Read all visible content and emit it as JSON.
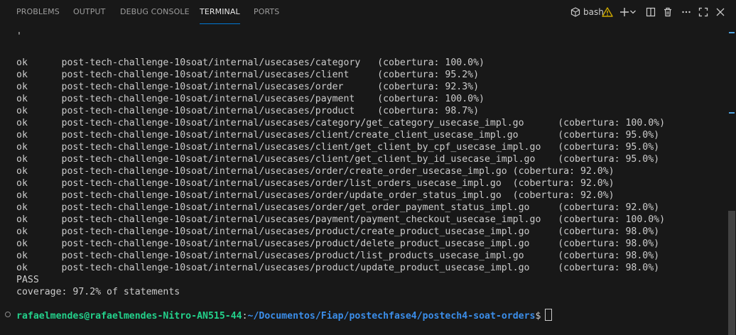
{
  "tabs": [
    {
      "label": "PROBLEMS",
      "active": false
    },
    {
      "label": "OUTPUT",
      "active": false
    },
    {
      "label": "DEBUG CONSOLE",
      "active": false
    },
    {
      "label": "TERMINAL",
      "active": true
    },
    {
      "label": "PORTS",
      "active": false
    }
  ],
  "toolbar": {
    "shell_label": "bash",
    "icons": [
      "terminal-profile-icon",
      "warning-icon",
      "add-icon",
      "chevron-down-icon",
      "split-icon",
      "trash-icon",
      "ellipsis-icon",
      "maximize-icon",
      "close-icon"
    ]
  },
  "colors": {
    "accent": "#0078d4",
    "warning": "#cca700",
    "prompt_user": "#23d18b",
    "prompt_path": "#3b8eea"
  },
  "terminal": {
    "lines": [
      "'",
      "",
      "ok      post-tech-challenge-10soat/internal/usecases/category   (cobertura: 100.0%)",
      "ok      post-tech-challenge-10soat/internal/usecases/client     (cobertura: 95.2%)",
      "ok      post-tech-challenge-10soat/internal/usecases/order      (cobertura: 92.3%)",
      "ok      post-tech-challenge-10soat/internal/usecases/payment    (cobertura: 100.0%)",
      "ok      post-tech-challenge-10soat/internal/usecases/product    (cobertura: 98.7%)",
      "ok      post-tech-challenge-10soat/internal/usecases/category/get_category_usecase_impl.go      (cobertura: 100.0%)",
      "ok      post-tech-challenge-10soat/internal/usecases/client/create_client_usecase_impl.go       (cobertura: 95.0%)",
      "ok      post-tech-challenge-10soat/internal/usecases/client/get_client_by_cpf_usecase_impl.go   (cobertura: 95.0%)",
      "ok      post-tech-challenge-10soat/internal/usecases/client/get_client_by_id_usecase_impl.go    (cobertura: 95.0%)",
      "ok      post-tech-challenge-10soat/internal/usecases/order/create_order_usecase_impl.go (cobertura: 92.0%)",
      "ok      post-tech-challenge-10soat/internal/usecases/order/list_orders_usecase_impl.go  (cobertura: 92.0%)",
      "ok      post-tech-challenge-10soat/internal/usecases/order/update_order_status_impl.go  (cobertura: 92.0%)",
      "ok      post-tech-challenge-10soat/internal/usecases/order/get_order_payment_status_impl.go     (cobertura: 92.0%)",
      "ok      post-tech-challenge-10soat/internal/usecases/payment/payment_checkout_usecase_impl.go   (cobertura: 100.0%)",
      "ok      post-tech-challenge-10soat/internal/usecases/product/create_product_usecase_impl.go     (cobertura: 98.0%)",
      "ok      post-tech-challenge-10soat/internal/usecases/product/delete_product_usecase_impl.go     (cobertura: 98.0%)",
      "ok      post-tech-challenge-10soat/internal/usecases/product/list_products_usecase_impl.go      (cobertura: 98.0%)",
      "ok      post-tech-challenge-10soat/internal/usecases/product/update_product_usecase_impl.go     (cobertura: 98.0%)",
      "PASS",
      "coverage: 97.2% of statements"
    ],
    "prompt": {
      "user_host": "rafaelmendes@rafaelmendes-Nitro-AN515-44",
      "separator": ":",
      "path": "~/Documentos/Fiap/postechfase4/postech4-soat-orders",
      "symbol": "$"
    }
  }
}
